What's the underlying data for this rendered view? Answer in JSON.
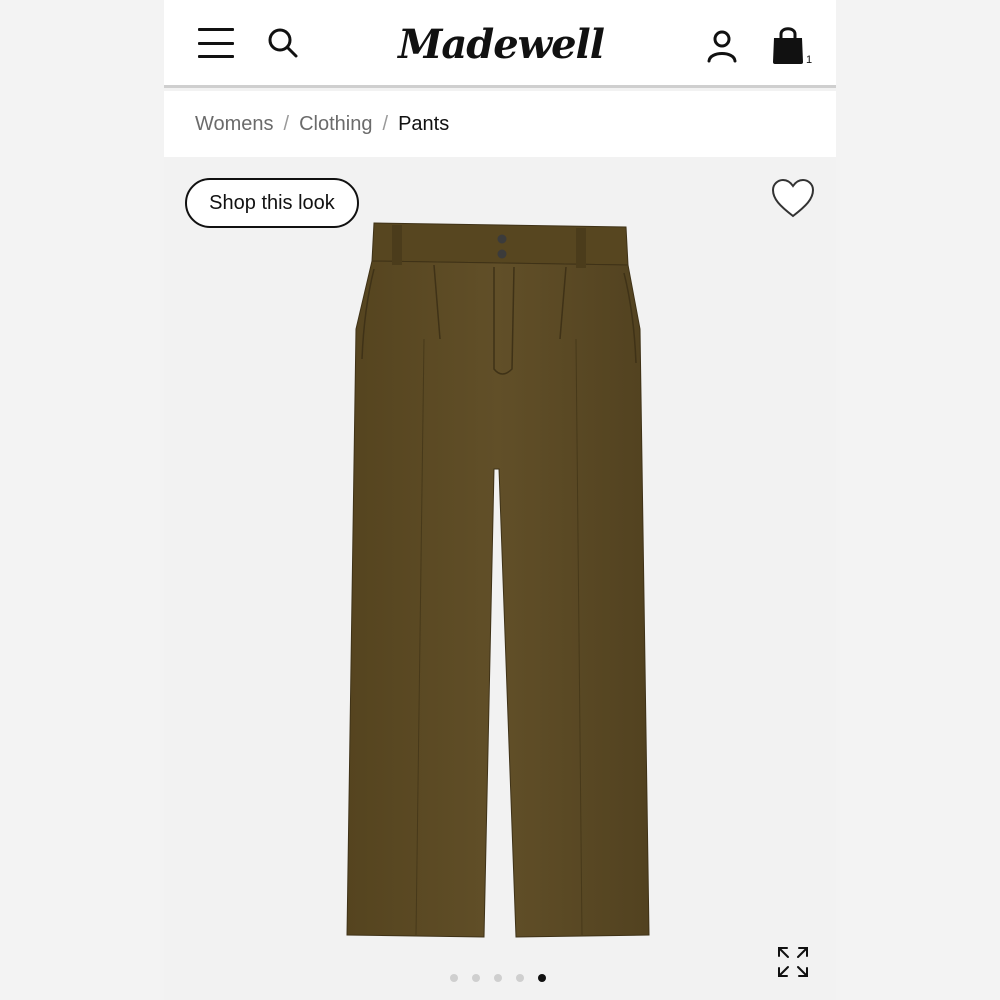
{
  "header": {
    "logo_text": "Madewell",
    "icons": [
      "menu-icon",
      "search-icon",
      "account-icon",
      "bag-icon"
    ],
    "bag_count": "1"
  },
  "breadcrumb": {
    "items": [
      {
        "label": "Womens"
      },
      {
        "label": "Clothing"
      },
      {
        "label": "Pants"
      }
    ],
    "separator": "/"
  },
  "product": {
    "shop_look_label": "Shop this look",
    "image_alt": "Brown pleated wide-leg trousers",
    "colors": {
      "fabric": "#5b4a26",
      "fabric_dark": "#4a3c1e",
      "button": "#3b3b3b"
    }
  },
  "carousel": {
    "total": 5,
    "active_index": 4
  }
}
